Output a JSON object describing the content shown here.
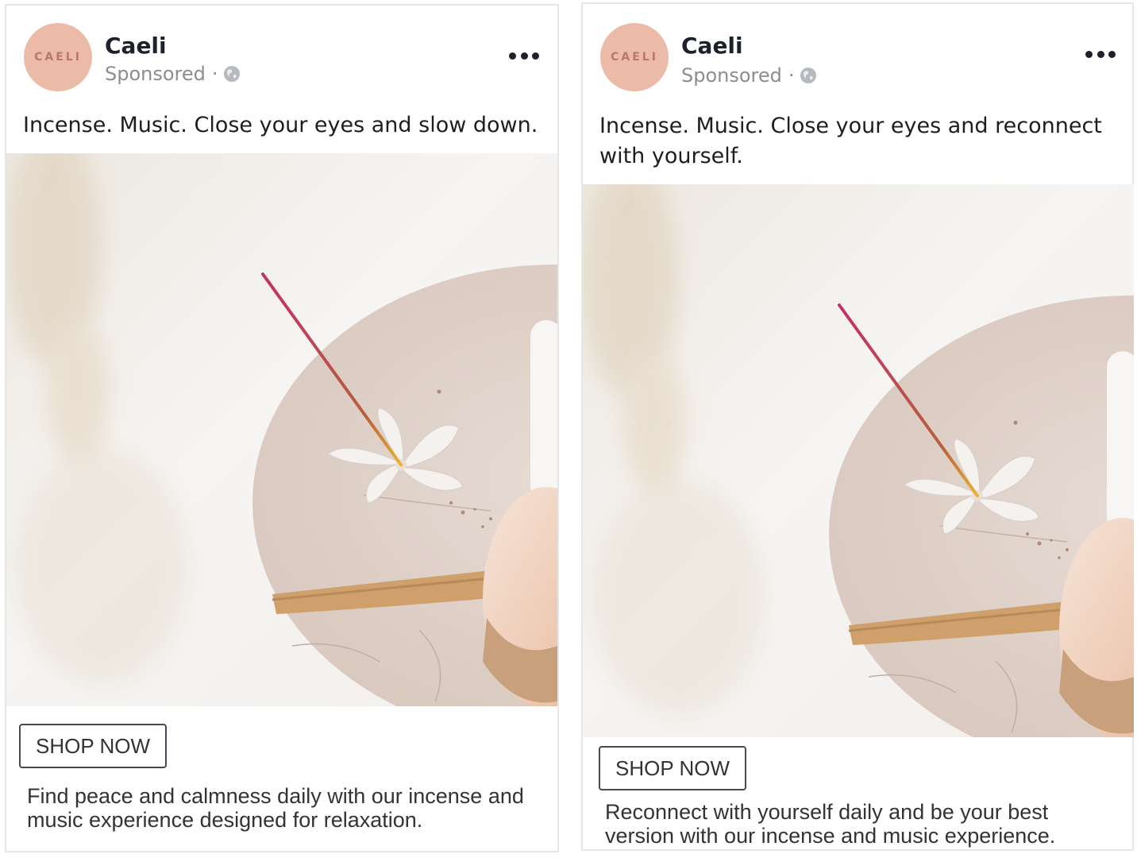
{
  "ads": [
    {
      "page_name": "Caeli",
      "avatar_text": "CAELI",
      "sponsored_label": "Sponsored",
      "separator": "·",
      "primary_text": "Incense. Music. Close your eyes and slow down.",
      "cta_label": "SHOP NOW",
      "description": "Find peace and calmness daily with our incense and music experience designed for relaxation."
    },
    {
      "page_name": "Caeli",
      "avatar_text": "CAELI",
      "sponsored_label": "Sponsored",
      "separator": "·",
      "primary_text": "Incense. Music. Close your eyes and reconnect with yourself.",
      "cta_label": "SHOP NOW",
      "description": "Reconnect with yourself daily and be your best version with our incense and music experience."
    }
  ],
  "icons": {
    "globe": "globe-icon",
    "more": "more-options-icon"
  },
  "colors": {
    "avatar_bg": "#ebbba8",
    "avatar_text": "#b9776a",
    "page_name": "#1d2129",
    "meta_text": "#8a8d91",
    "cta_border": "#444a52"
  }
}
